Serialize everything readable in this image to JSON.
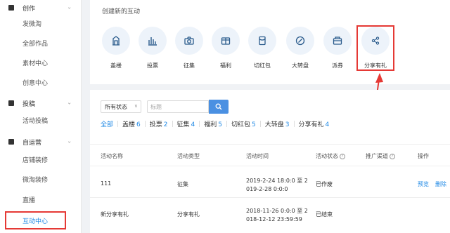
{
  "sidebar": {
    "groups": [
      {
        "label": "创作",
        "icon": "edit-icon"
      },
      {
        "label": "投稿",
        "icon": "document-icon"
      },
      {
        "label": "自运营",
        "icon": "box-icon"
      }
    ],
    "create_items": [
      "发微淘",
      "全部作品",
      "素材中心",
      "创意中心"
    ],
    "submit_items": [
      "活动投稿"
    ],
    "ops_items": [
      "店铺装修",
      "微淘装修",
      "直播"
    ],
    "active_item": "互动中心"
  },
  "create": {
    "title": "创建新的互动",
    "tools": [
      {
        "label": "盖楼",
        "icon": "building-icon"
      },
      {
        "label": "投票",
        "icon": "bar-chart-icon"
      },
      {
        "label": "征集",
        "icon": "camera-icon"
      },
      {
        "label": "福利",
        "icon": "gift-box-icon"
      },
      {
        "label": "切红包",
        "icon": "red-packet-icon"
      },
      {
        "label": "大转盘",
        "icon": "wheel-icon"
      },
      {
        "label": "派券",
        "icon": "coupon-icon"
      },
      {
        "label": "分享有礼",
        "icon": "share-icon"
      }
    ]
  },
  "filter": {
    "status_value": "所有状态",
    "search_placeholder": "标题"
  },
  "tabs": [
    {
      "label": "全部",
      "count": ""
    },
    {
      "label": "盖楼",
      "count": "6"
    },
    {
      "label": "投票",
      "count": "2"
    },
    {
      "label": "征集",
      "count": "4"
    },
    {
      "label": "福利",
      "count": "5"
    },
    {
      "label": "切红包",
      "count": "5"
    },
    {
      "label": "大转盘",
      "count": "3"
    },
    {
      "label": "分享有礼",
      "count": "4"
    }
  ],
  "table": {
    "headers": [
      "活动名称",
      "活动类型",
      "活动时间",
      "活动状态",
      "推广渠道",
      "操作"
    ],
    "rows": [
      {
        "name": "111",
        "type": "征集",
        "time1": "2019-2-24 18:0:0 至 2",
        "time2": "019-2-28 0:0:0",
        "status": "已作废",
        "actions": [
          "预览",
          "删除"
        ]
      },
      {
        "name": "新分享有礼",
        "type": "分享有礼",
        "time1": "2018-11-26 0:0:0 至 2",
        "time2": "018-12-12 23:59:59",
        "status": "已结束",
        "actions": []
      }
    ]
  },
  "colors": {
    "accent": "#1e88e5",
    "highlight": "#e53935",
    "button": "#4a90e2"
  }
}
